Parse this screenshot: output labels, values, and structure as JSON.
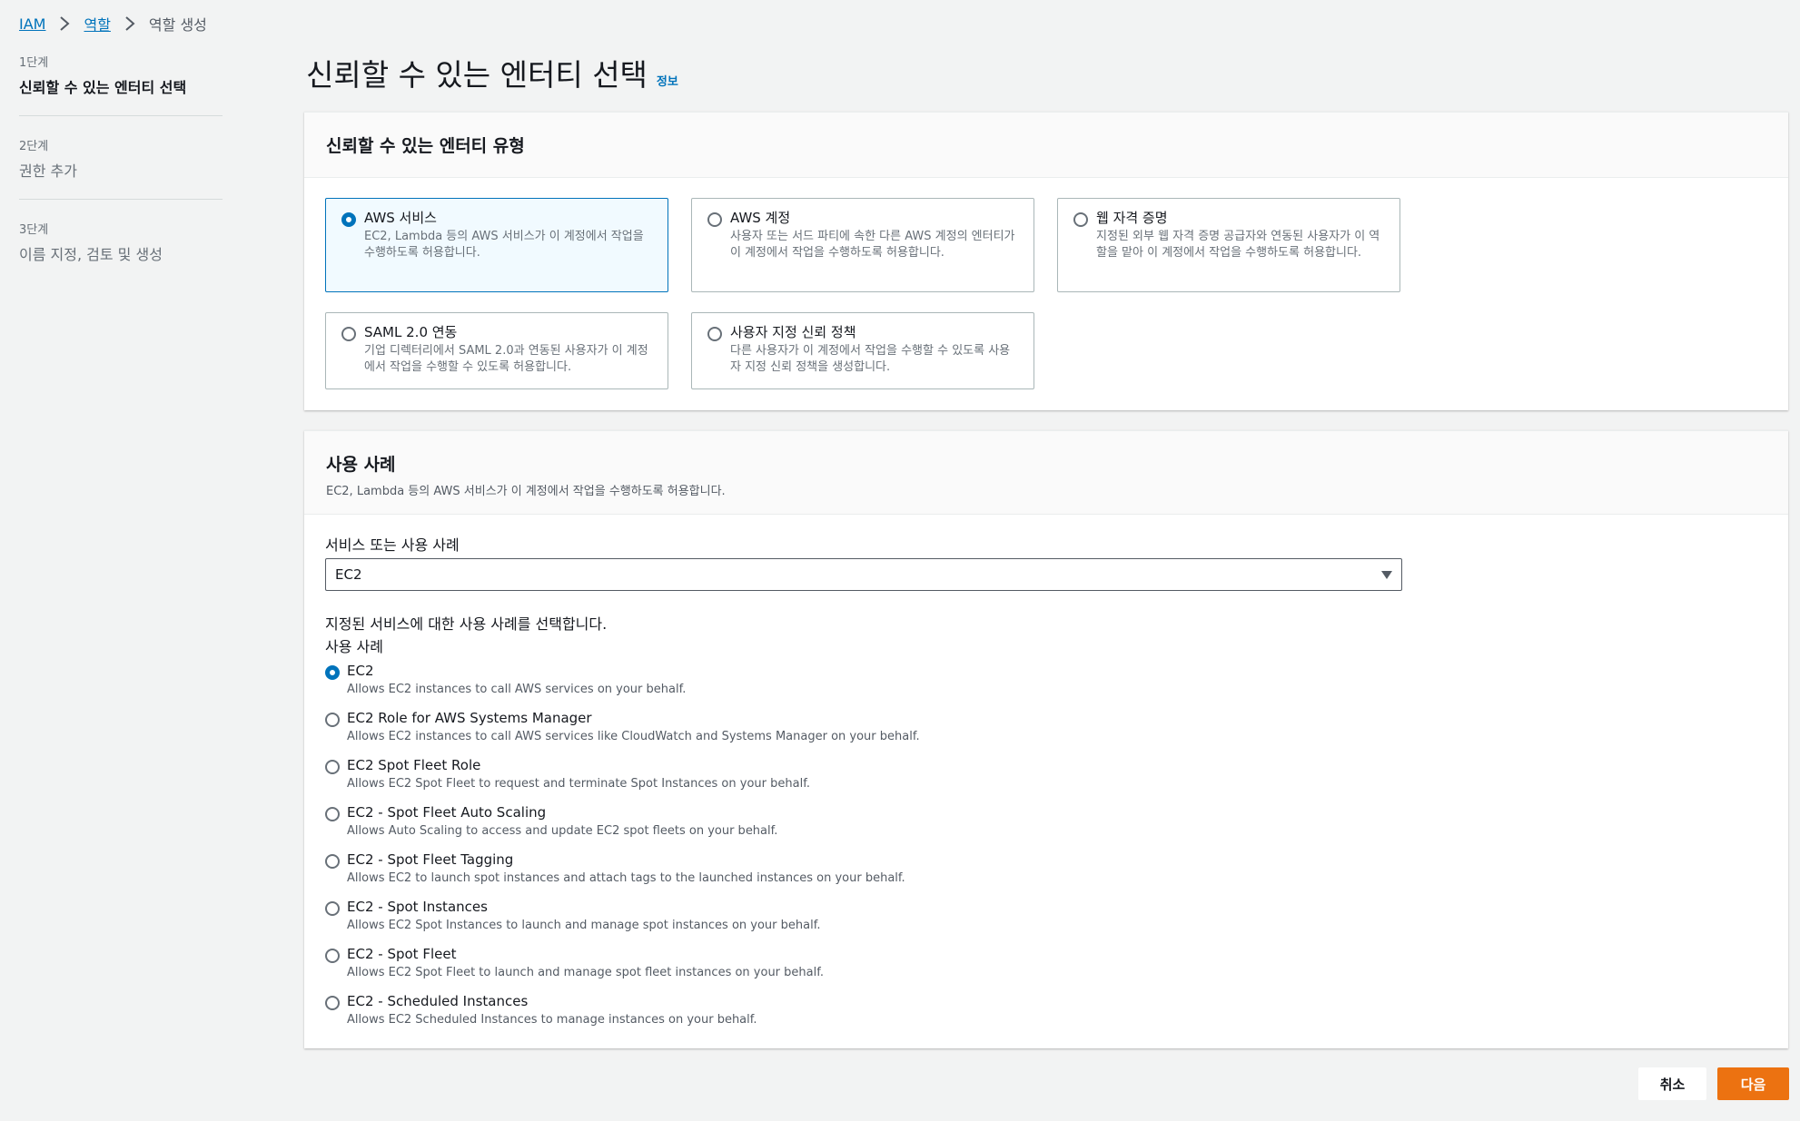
{
  "breadcrumb": {
    "iam": "IAM",
    "roles": "역할",
    "current": "역할 생성"
  },
  "steps": [
    {
      "num": "1단계",
      "name": "신뢰할 수 있는 엔터티 선택"
    },
    {
      "num": "2단계",
      "name": "권한 추가"
    },
    {
      "num": "3단계",
      "name": "이름 지정, 검토 및 생성"
    }
  ],
  "page": {
    "title": "신뢰할 수 있는 엔터티 선택",
    "info": "정보"
  },
  "entity": {
    "heading": "신뢰할 수 있는 엔터티 유형",
    "tiles": [
      {
        "title": "AWS 서비스",
        "desc": "EC2, Lambda 등의 AWS 서비스가 이 계정에서 작업을 수행하도록 허용합니다."
      },
      {
        "title": "AWS 계정",
        "desc": "사용자 또는 서드 파티에 속한 다른 AWS 계정의 엔터티가 이 계정에서 작업을 수행하도록 허용합니다."
      },
      {
        "title": "웹 자격 증명",
        "desc": "지정된 외부 웹 자격 증명 공급자와 연동된 사용자가 이 역할을 맡아 이 계정에서 작업을 수행하도록 허용합니다."
      },
      {
        "title": "SAML 2.0 연동",
        "desc": "기업 디렉터리에서 SAML 2.0과 연동된 사용자가 이 계정에서 작업을 수행할 수 있도록 허용합니다."
      },
      {
        "title": "사용자 지정 신뢰 정책",
        "desc": "다른 사용자가 이 계정에서 작업을 수행할 수 있도록 사용자 지정 신뢰 정책을 생성합니다."
      }
    ]
  },
  "usecase": {
    "heading": "사용 사례",
    "desc": "EC2, Lambda 등의 AWS 서비스가 이 계정에서 작업을 수행하도록 허용합니다.",
    "service_label": "서비스 또는 사용 사례",
    "service_value": "EC2",
    "choose_text": "지정된 서비스에 대한 사용 사례를 선택합니다.",
    "list_label": "사용 사례",
    "options": [
      {
        "title": "EC2",
        "desc": "Allows EC2 instances to call AWS services on your behalf."
      },
      {
        "title": "EC2 Role for AWS Systems Manager",
        "desc": "Allows EC2 instances to call AWS services like CloudWatch and Systems Manager on your behalf."
      },
      {
        "title": "EC2 Spot Fleet Role",
        "desc": "Allows EC2 Spot Fleet to request and terminate Spot Instances on your behalf."
      },
      {
        "title": "EC2 - Spot Fleet Auto Scaling",
        "desc": "Allows Auto Scaling to access and update EC2 spot fleets on your behalf."
      },
      {
        "title": "EC2 - Spot Fleet Tagging",
        "desc": "Allows EC2 to launch spot instances and attach tags to the launched instances on your behalf."
      },
      {
        "title": "EC2 - Spot Instances",
        "desc": "Allows EC2 Spot Instances to launch and manage spot instances on your behalf."
      },
      {
        "title": "EC2 - Spot Fleet",
        "desc": "Allows EC2 Spot Fleet to launch and manage spot fleet instances on your behalf."
      },
      {
        "title": "EC2 - Scheduled Instances",
        "desc": "Allows EC2 Scheduled Instances to manage instances on your behalf."
      }
    ]
  },
  "footer": {
    "cancel": "취소",
    "next": "다음"
  },
  "colors": {
    "accent": "#0073bb",
    "primary_button": "#ec7211"
  }
}
